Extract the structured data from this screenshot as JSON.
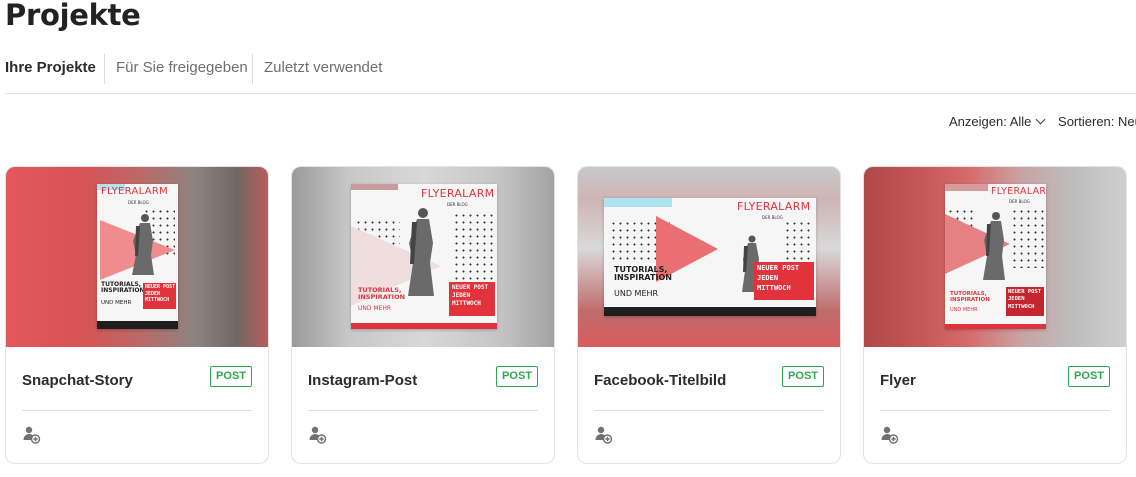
{
  "page": {
    "title": "Projekte"
  },
  "tabs": [
    {
      "label": "Ihre Projekte",
      "active": true
    },
    {
      "label": "Für Sie freigegeben",
      "active": false
    },
    {
      "label": "Zuletzt verwendet",
      "active": false
    }
  ],
  "controls": {
    "show_label": "Anzeigen: Alle",
    "sort_label": "Sortieren: Neu"
  },
  "colors": {
    "accent_red": "#e2323c",
    "badge_green": "#2ea84f"
  },
  "artwork": {
    "brand": "FLYERALARM",
    "sub": "DER BLOG",
    "tagline": "TUTORIALS,\nINSPIRATION",
    "tagline_more": "UND MEHR",
    "promo": "NEUER POST\nJEDEN\nMITTWOCH"
  },
  "projects": [
    {
      "title": "Snapchat-Story",
      "badge": "POST",
      "share_icon": "add-user-icon"
    },
    {
      "title": "Instagram-Post",
      "badge": "POST",
      "share_icon": "add-user-icon"
    },
    {
      "title": "Facebook-Titelbild",
      "badge": "POST",
      "share_icon": "add-user-icon"
    },
    {
      "title": "Flyer",
      "badge": "POST",
      "share_icon": "add-user-icon"
    }
  ]
}
